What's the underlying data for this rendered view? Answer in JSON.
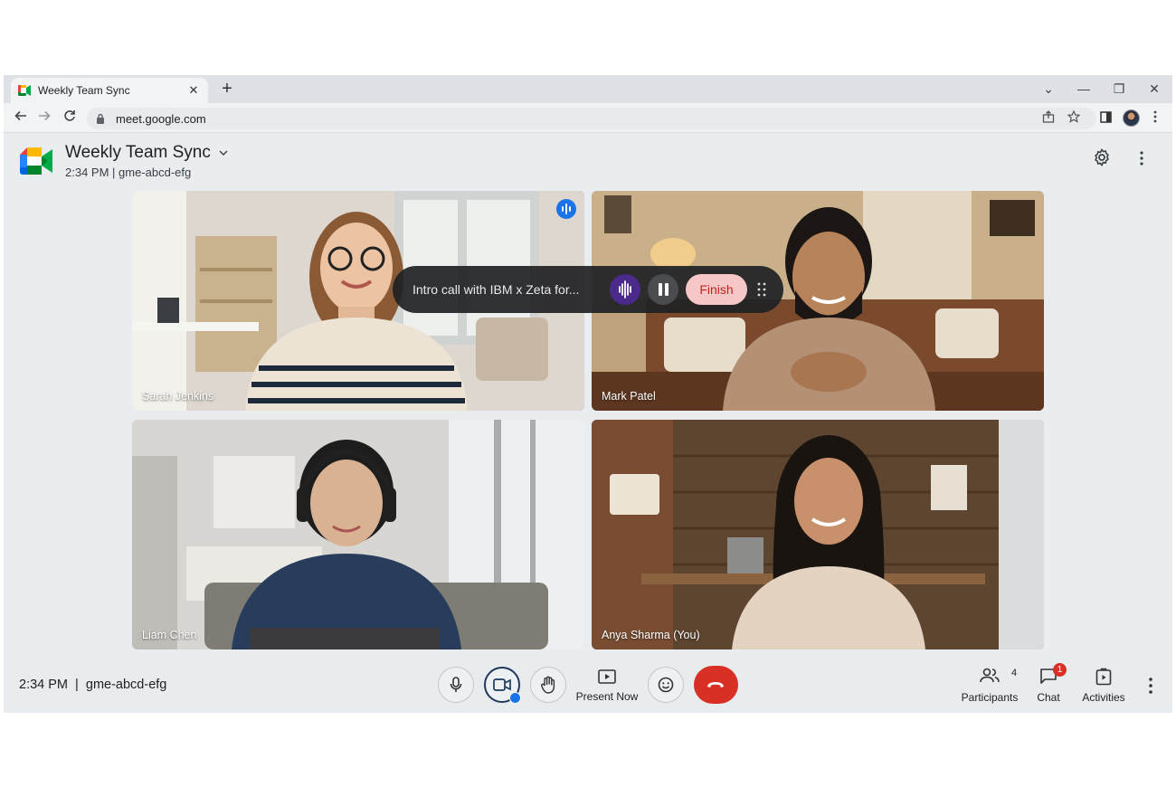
{
  "browser": {
    "tab_title": "Weekly Team Sync",
    "tab_close": "✕",
    "new_tab": "+",
    "url": "meet.google.com",
    "window_controls": {
      "dropdown": "⌄",
      "minimize": "—",
      "restore": "❐",
      "close": "✕"
    }
  },
  "meeting": {
    "title": "Weekly Team Sync",
    "time": "2:34 PM",
    "code": "gme-abcd-efg",
    "subtitle": "2:34 PM | gme-abcd-efg"
  },
  "participants": [
    {
      "name": "Sarah Jenkins",
      "active_speaker": true
    },
    {
      "name": "Mark Patel",
      "active_speaker": false
    },
    {
      "name": "Liam Chen",
      "active_speaker": false
    },
    {
      "name": "Anya Sharma (You)",
      "active_speaker": false
    }
  ],
  "recording": {
    "title": "Intro call with IBM x Zeta for...",
    "finish_label": "Finish"
  },
  "bottom_bar": {
    "info": "2:34 PM  |  gme-abcd-efg",
    "present_label": "Present Now",
    "participants_label": "Participants",
    "participants_count": "4",
    "chat_label": "Chat",
    "chat_badge": "1",
    "activities_label": "Activities"
  },
  "colors": {
    "active_outline": "#1a5fc4",
    "end_call": "#d93025",
    "finish_bg": "#f7c6c7",
    "recording_wave": "#4b2a8c"
  },
  "icons": [
    "back-icon",
    "forward-icon",
    "reload-icon",
    "lock-icon",
    "share-icon",
    "star-icon",
    "side-panel-icon",
    "settings-icon",
    "more-vert-icon",
    "mic-icon",
    "camera-icon",
    "hand-icon",
    "present-icon",
    "emoji-icon",
    "end-call-icon",
    "participants-icon",
    "chat-icon",
    "activities-icon",
    "audio-wave-icon",
    "pause-icon",
    "drag-handle-icon"
  ]
}
